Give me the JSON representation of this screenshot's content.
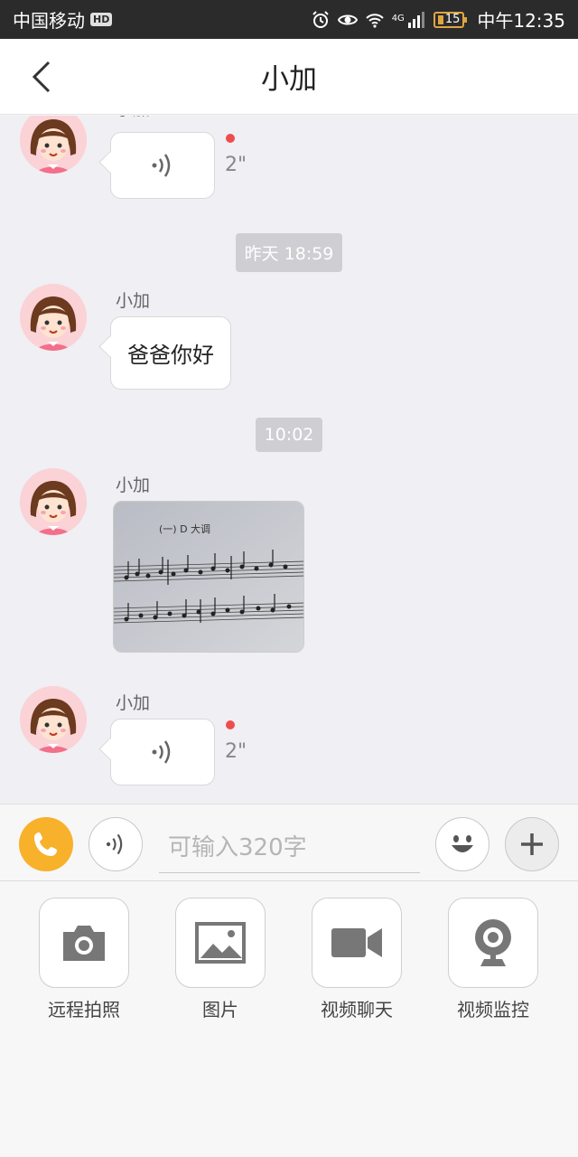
{
  "status_bar": {
    "carrier": "中国移动",
    "hd_badge": "HD",
    "network": "4G",
    "battery": "15",
    "time": "中午12:35"
  },
  "header": {
    "title": "小加",
    "back_icon": "chevron-left-icon"
  },
  "messages": [
    {
      "type": "voice",
      "sender": "小加",
      "duration": "2\"",
      "unread": true
    },
    {
      "type": "timestamp",
      "text": "昨天 18:59"
    },
    {
      "type": "text",
      "sender": "小加",
      "text": "爸爸你好"
    },
    {
      "type": "timestamp",
      "text": "10:02"
    },
    {
      "type": "image",
      "sender": "小加",
      "image_caption": "(一) D 大调"
    },
    {
      "type": "voice",
      "sender": "小加",
      "duration": "2\"",
      "unread": true
    }
  ],
  "input_bar": {
    "placeholder": "可输入320字",
    "phone_icon": "phone-icon",
    "voice_icon": "voice-icon",
    "emoji_icon": "smiley-icon",
    "plus_icon": "plus-icon",
    "accent_color": "#f8b12a"
  },
  "actions": [
    {
      "label": "远程拍照",
      "icon": "camera-icon"
    },
    {
      "label": "图片",
      "icon": "image-icon"
    },
    {
      "label": "视频聊天",
      "icon": "video-camera-icon"
    },
    {
      "label": "视频监控",
      "icon": "webcam-icon"
    }
  ]
}
